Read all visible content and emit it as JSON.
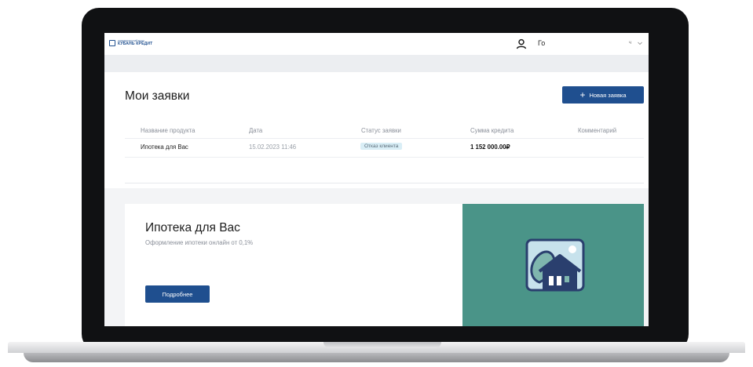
{
  "header": {
    "logo_small": "КОММЕРЧЕСКИЙ БАНК",
    "logo_big": "КУБАНЬ КРЕДИТ",
    "user_name": "Го",
    "user_suffix": "ч"
  },
  "page": {
    "title": "Мои заявки",
    "new_request_label": "Новая заявка"
  },
  "table": {
    "headers": [
      "Название продукта",
      "Дата",
      "Статус заявки",
      "Сумма кредита",
      "Комментарий"
    ],
    "rows": [
      {
        "product": "Ипотека для Вас",
        "date": "15.02.2023 11:46",
        "status": "Отказ клиента",
        "amount": "1 152 000.00₽",
        "comment": ""
      }
    ]
  },
  "promo": {
    "title": "Ипотека для Вас",
    "subtitle": "Оформление ипотеки онлайн от 0,1%",
    "button_label": "Подробнее"
  },
  "colors": {
    "brand": "#1f4f8f",
    "promo_bg": "#4a9488",
    "status_badge_bg": "#d9eef6"
  },
  "icons": {
    "user": "user-icon",
    "chevron": "chevron-down-icon",
    "plus": "plus-icon",
    "promo": "house-icon"
  }
}
